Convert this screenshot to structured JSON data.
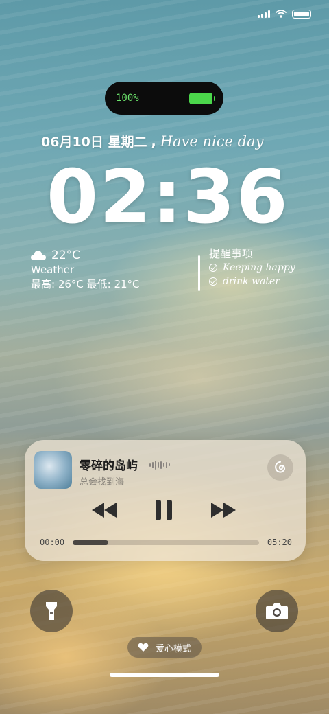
{
  "status_bar": {
    "icons": [
      "signal-icon",
      "wifi-icon",
      "battery-icon"
    ]
  },
  "island": {
    "battery_percent": "100%"
  },
  "date": {
    "date_text": "06月10日 星期二",
    "separator": ",",
    "greeting": "Have nice day"
  },
  "clock": {
    "time": "02:36"
  },
  "weather": {
    "temp": "22°C",
    "label": "Weather",
    "range": "最高: 26°C 最低: 21°C",
    "icon": "cloud-icon"
  },
  "reminder": {
    "title": "提醒事项",
    "items": [
      "Keeping happy",
      "drink water"
    ]
  },
  "player": {
    "song_title": "零碎的岛屿",
    "artist": "总会找到海",
    "current_time": "00:00",
    "total_time": "05:20",
    "progress": 0.19,
    "icons": {
      "prev": "previous-icon",
      "pause": "pause-icon",
      "next": "next-icon",
      "app": "netease-music-icon"
    }
  },
  "shortcuts": {
    "left": "flashlight-icon",
    "right": "camera-icon"
  },
  "love_mode": {
    "label": "爱心模式",
    "icon": "heart-icon"
  },
  "colors": {
    "battery_green": "#4bd64b",
    "island_bg": "#0c0c0c",
    "player_bg": "#ebe1d2"
  }
}
